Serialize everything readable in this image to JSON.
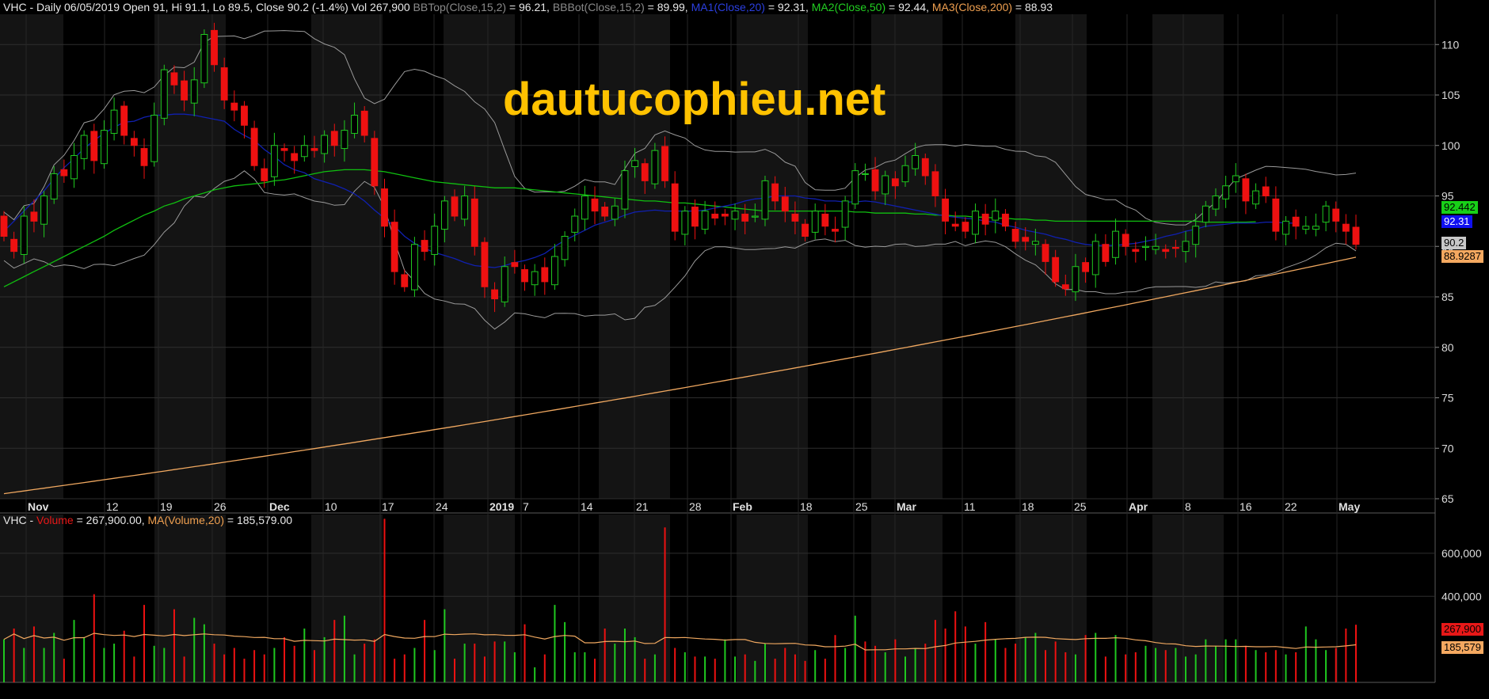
{
  "header": {
    "ticker": "VHC",
    "summary": "VHC - Daily 06/05/2019 Open 91, Hi 91.1, Lo 89.5, Close 90.2 (-1.4%) Vol 267,900",
    "bbtop_label": "BBTop(Close,15,2)",
    "bbtop_value": " = 96.21, ",
    "bbbot_label": "BBBot(Close,15,2)",
    "bbbot_value": " = 89.99, ",
    "ma1_label": "MA1(Close,20)",
    "ma1_value": " = 92.31, ",
    "ma2_label": "MA2(Close,50)",
    "ma2_value": " = 92.44, ",
    "ma3_label": "MA3(Close,200)",
    "ma3_value": " = 88.93"
  },
  "volume_header": {
    "prefix": "VHC - ",
    "volume_label": "Volume",
    "volume_value": " = 267,900.00, ",
    "ma_label": "MA(Volume,20)",
    "ma_value": " = 185,579.00"
  },
  "watermark": "dautucophieu.net",
  "price_tags": {
    "ma2": "92.442",
    "ma1": "92.31",
    "close": "90.2",
    "ma3": "88.9287"
  },
  "volume_tags": {
    "volume": "267,900",
    "ma": "185,579"
  },
  "colors": {
    "up": "#1fc81f",
    "down": "#ee1111",
    "ma1": "#1020b0",
    "ma2": "#10c010",
    "ma3": "#f0a860",
    "bbands": "#9a9a9a",
    "background": "#000000",
    "panel_band": "#141414"
  },
  "chart_data": [
    {
      "type": "candlestick",
      "title": "VHC - Daily",
      "ylim": [
        65,
        113
      ],
      "y_ticks": [
        "110",
        "105",
        "100",
        "95",
        "90",
        "85",
        "80",
        "75",
        "70",
        "65"
      ],
      "x_labels": [
        "Nov",
        "12",
        "19",
        "26",
        "Dec",
        "10",
        "17",
        "24",
        "2019",
        "7",
        "14",
        "21",
        "28",
        "Feb",
        "18",
        "25",
        "Mar",
        "11",
        "18",
        "25",
        "Apr",
        "8",
        "16",
        "22",
        "May"
      ],
      "x_label_bold": [
        "Nov",
        "Dec",
        "2019",
        "Feb",
        "Mar",
        "Apr",
        "May"
      ],
      "closes": [
        91,
        89.5,
        93,
        92.5,
        95,
        97.2,
        97,
        99,
        101,
        98.5,
        101.5,
        103.5,
        101,
        100,
        98,
        103,
        107.5,
        106,
        104.5,
        106.5,
        111,
        108,
        104.5,
        103.5,
        102,
        98,
        96.5,
        100,
        99.5,
        98.5,
        100,
        99.5,
        101,
        100,
        101.5,
        103,
        101,
        96,
        92,
        87.5,
        86,
        90.2,
        89.5,
        92,
        94.5,
        93,
        95,
        90,
        86,
        84.8,
        88,
        88,
        86.5,
        87.5,
        86.5,
        89,
        91,
        93,
        95,
        93.5,
        93,
        94,
        97.5,
        98.5,
        96.5,
        99.5,
        96.5,
        91.5,
        93.5,
        92,
        93.5,
        92.8,
        93,
        93.5,
        92.5,
        93,
        96.5,
        94.5,
        93.5,
        92.5,
        91,
        93.5,
        92,
        91.5,
        94.5,
        97.5,
        97.2,
        95.5,
        97,
        96,
        98,
        99,
        97,
        95,
        92.5,
        92,
        91.5,
        93.5,
        92.2,
        93.5,
        92,
        90.5,
        90.5,
        90.5,
        88.5,
        86.5,
        85.8,
        88,
        87.5,
        90.5,
        88.5,
        91.5,
        90,
        89.5,
        90,
        90,
        89.5,
        89.8,
        90.5,
        92,
        94,
        95,
        96,
        97,
        94.5,
        95.5,
        95,
        91.5,
        92.5,
        92,
        92,
        92,
        94,
        92.5,
        91.5,
        90.2
      ],
      "volumes": [
        200000,
        250000,
        160000,
        260000,
        160000,
        230000,
        110000,
        290000,
        210000,
        410000,
        160000,
        180000,
        240000,
        120000,
        360000,
        170000,
        160000,
        340000,
        120000,
        300000,
        270000,
        180000,
        130000,
        160000,
        110000,
        150000,
        130000,
        160000,
        210000,
        170000,
        250000,
        150000,
        210000,
        290000,
        310000,
        130000,
        180000,
        200000,
        760000,
        110000,
        130000,
        160000,
        290000,
        150000,
        340000,
        110000,
        180000,
        180000,
        120000,
        190000,
        190000,
        140000,
        270000,
        70000,
        130000,
        360000,
        280000,
        140000,
        140000,
        110000,
        250000,
        180000,
        250000,
        210000,
        110000,
        130000,
        720000,
        160000,
        140000,
        120000,
        120000,
        110000,
        200000,
        120000,
        130000,
        100000,
        180000,
        110000,
        160000,
        130000,
        100000,
        150000,
        110000,
        220000,
        160000,
        310000,
        190000,
        170000,
        140000,
        200000,
        120000,
        160000,
        180000,
        290000,
        250000,
        330000,
        260000,
        180000,
        280000,
        200000,
        160000,
        180000,
        210000,
        230000,
        150000,
        190000,
        140000,
        130000,
        220000,
        230000,
        120000,
        220000,
        130000,
        140000,
        170000,
        160000,
        150000,
        160000,
        120000,
        130000,
        200000,
        170000,
        200000,
        200000,
        170000,
        150000,
        140000,
        150000,
        130000,
        140000,
        260000,
        200000,
        150000,
        160000,
        250000,
        267900
      ],
      "ma1": [
        91.5,
        92.5,
        93.5,
        94.5,
        95.5,
        96.7,
        97.8,
        98.7,
        99.7,
        100.5,
        101.2,
        101.8,
        102.3,
        102.4,
        102.8,
        103.0,
        103.0,
        103.1,
        103.1,
        103.0,
        102.8,
        102.6,
        102.4,
        101.6,
        101.0,
        100.5,
        99.6,
        98.9,
        98.1,
        97.6,
        97.3,
        96.7,
        96.4,
        96.1,
        95.7,
        95.2,
        94.5,
        93.6,
        92.8,
        92.0,
        91.0,
        90.3,
        89.8,
        89.4,
        89.1,
        88.8,
        88.4,
        88.1,
        88.0,
        87.9,
        88.1,
        88.4,
        88.6,
        88.9,
        89.3,
        90.0,
        90.6,
        91.1,
        91.6,
        92.1,
        92.4,
        92.7,
        93.1,
        93.4,
        93.5,
        93.6,
        93.5,
        93.5,
        93.5,
        93.5,
        93.6,
        93.8,
        94.0,
        94.2,
        94.5,
        94.7,
        94.8,
        95.0,
        95.0,
        95.0,
        94.8,
        94.7,
        94.5,
        94.5,
        94.4,
        94.4,
        94.5,
        94.4,
        94.2,
        94.0,
        93.8,
        93.6,
        93.4,
        93.2,
        93.0,
        92.9,
        92.8,
        92.7,
        92.5,
        92.4,
        92.1,
        91.9,
        91.6,
        91.4,
        91.2,
        90.9,
        90.7,
        90.4,
        90.2,
        90.1,
        90.1,
        90.1,
        90.2,
        90.3,
        90.5,
        90.7,
        91.0,
        91.2,
        91.5,
        91.7,
        92.0,
        92.1,
        92.2,
        92.3,
        92.3,
        92.3,
        92.4,
        92.4,
        92.3,
        92.31
      ],
      "ma2": [
        86,
        86.5,
        87,
        87.5,
        88,
        88.5,
        89,
        89.5,
        90,
        90.5,
        91,
        91.6,
        92.1,
        92.6,
        93.1,
        93.5,
        94,
        94.3,
        94.7,
        95,
        95.3,
        95.6,
        95.8,
        96,
        96.1,
        96.2,
        96.3,
        96.5,
        96.6,
        96.8,
        97,
        97.2,
        97.4,
        97.5,
        97.6,
        97.6,
        97.6,
        97.5,
        97.4,
        97.2,
        97,
        96.8,
        96.6,
        96.4,
        96.3,
        96.2,
        96.1,
        96,
        95.9,
        95.8,
        95.8,
        95.8,
        95.7,
        95.6,
        95.5,
        95.4,
        95.3,
        95.2,
        95.1,
        95,
        94.9,
        94.8,
        94.7,
        94.6,
        94.5,
        94.5,
        94.4,
        94.3,
        94.3,
        94.2,
        94.1,
        94,
        93.9,
        93.8,
        93.7,
        93.6,
        93.5,
        93.5,
        93.5,
        93.5,
        93.5,
        93.5,
        93.5,
        93.5,
        93.5,
        93.4,
        93.4,
        93.3,
        93.3,
        93.3,
        93.3,
        93.2,
        93.2,
        93.1,
        93.1,
        93.0,
        93.0,
        92.9,
        92.9,
        92.8,
        92.8,
        92.7,
        92.7,
        92.6,
        92.6,
        92.5,
        92.5,
        92.5,
        92.5,
        92.5,
        92.5,
        92.5,
        92.5,
        92.5,
        92.5,
        92.5,
        92.5,
        92.5,
        92.5,
        92.5,
        92.4,
        92.4,
        92.4,
        92.4,
        92.4,
        92.44
      ],
      "ma3_start": 65.5,
      "ma3_end": 88.93,
      "bb_top_end": 96.21,
      "bb_bot_end": 89.99
    },
    {
      "type": "bar",
      "title": "Volume",
      "ylim": [
        0,
        780000
      ],
      "y_ticks": [
        "600,000",
        "400,000"
      ],
      "series": [
        {
          "name": "Volume"
        },
        {
          "name": "MA(Volume,20)"
        }
      ]
    }
  ]
}
